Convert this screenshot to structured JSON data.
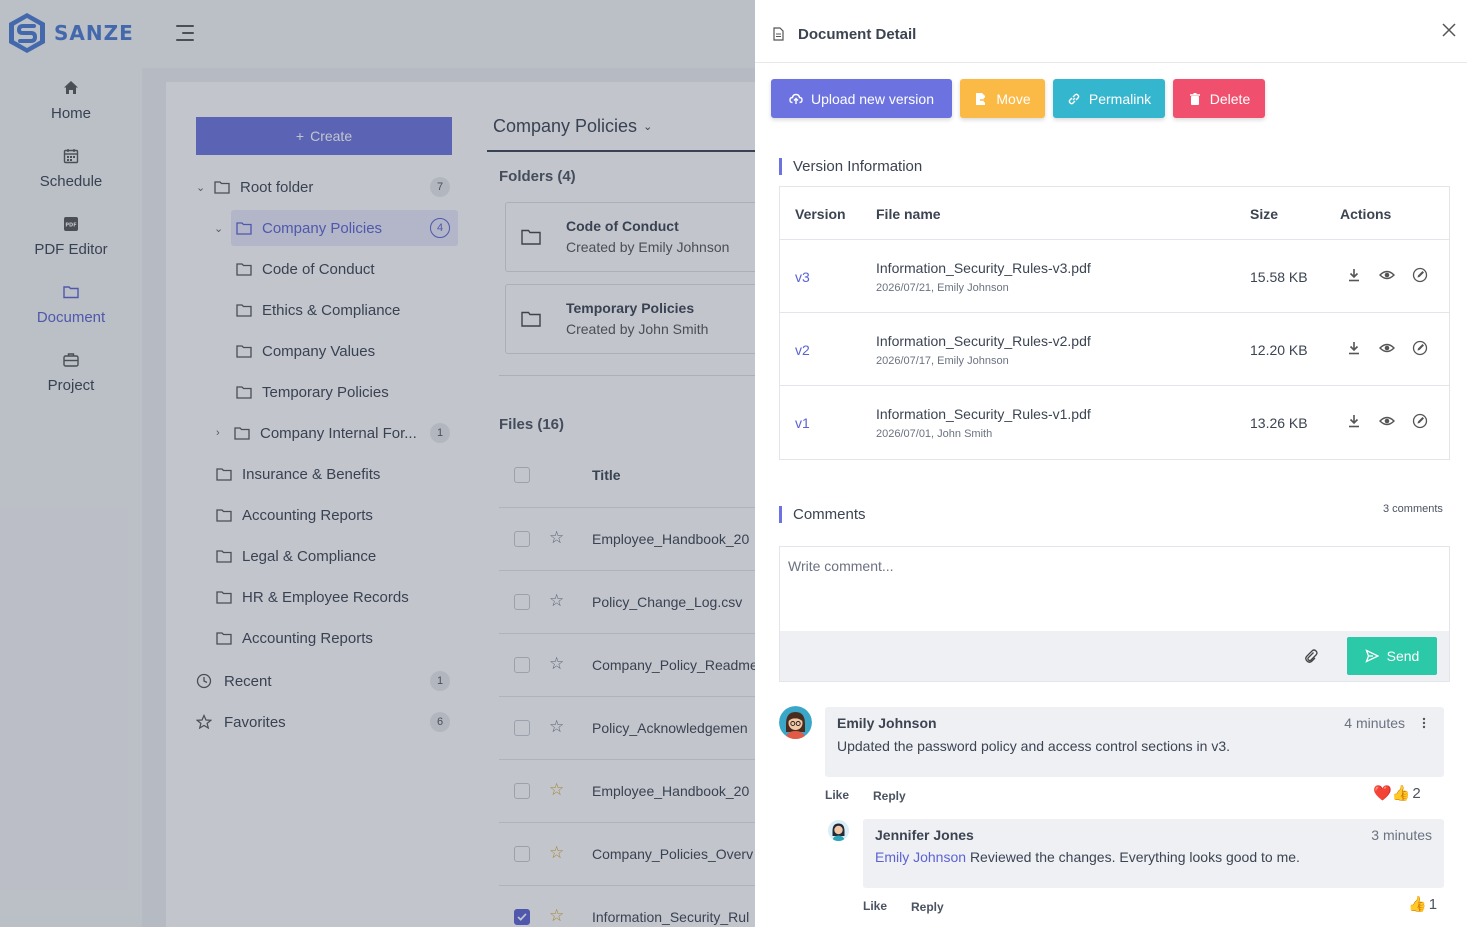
{
  "app": {
    "logo_text": "SANZE",
    "nav": [
      {
        "label": "Home",
        "icon": "home-icon"
      },
      {
        "label": "Schedule",
        "icon": "calendar-icon"
      },
      {
        "label": "PDF Editor",
        "icon": "pdf-icon"
      },
      {
        "label": "Document",
        "icon": "folder-icon",
        "active": true
      },
      {
        "label": "Project",
        "icon": "briefcase-icon"
      }
    ]
  },
  "tree": {
    "create_label": "Create",
    "root": {
      "label": "Root folder",
      "count": "7"
    },
    "selected": {
      "label": "Company Policies",
      "count": "4"
    },
    "children": [
      "Code of Conduct",
      "Ethics & Compliance",
      "Company Values",
      "Temporary Policies"
    ],
    "internal": {
      "label": "Company Internal For...",
      "count": "1"
    },
    "siblings": [
      "Insurance & Benefits",
      "Accounting Reports",
      "Legal & Compliance",
      "HR & Employee Records",
      "Accounting Reports"
    ],
    "recent": {
      "label": "Recent",
      "count": "1"
    },
    "favorites": {
      "label": "Favorites",
      "count": "6"
    }
  },
  "main": {
    "title": "Company Policies",
    "folders_label": "Folders (4)",
    "folders": [
      {
        "name": "Code of Conduct",
        "created": "Created by Emily Johnson"
      },
      {
        "name": "Temporary Policies",
        "created": "Created by John Smith"
      }
    ],
    "files_label": "Files (16)",
    "title_header": "Title",
    "files": [
      {
        "name": "Employee_Handbook_20",
        "starred": false,
        "checked": false
      },
      {
        "name": "Policy_Change_Log.csv",
        "starred": false,
        "checked": false
      },
      {
        "name": "Company_Policy_Readme",
        "starred": false,
        "checked": false
      },
      {
        "name": "Policy_Acknowledgemen",
        "starred": false,
        "checked": false
      },
      {
        "name": "Employee_Handbook_20",
        "starred": true,
        "checked": false
      },
      {
        "name": "Company_Policies_Overv",
        "starred": true,
        "checked": false
      },
      {
        "name": "Information_Security_Rul",
        "starred": true,
        "checked": true
      }
    ]
  },
  "drawer": {
    "title": "Document Detail",
    "buttons": {
      "upload": "Upload new version",
      "move": "Move",
      "permalink": "Permalink",
      "delete": "Delete"
    },
    "colors": {
      "primary": "#6c73e0",
      "warning": "#fbb946",
      "info": "#35b6cf",
      "danger": "#f0506e",
      "success": "#2cc9a8"
    },
    "version_section": "Version Information",
    "version_table": {
      "headers": {
        "version": "Version",
        "file": "File name",
        "size": "Size",
        "actions": "Actions"
      },
      "rows": [
        {
          "version": "v3",
          "file": "Information_Security_Rules-v3.pdf",
          "meta": "2026/07/21, Emily Johnson",
          "size": "15.58 KB"
        },
        {
          "version": "v2",
          "file": "Information_Security_Rules-v2.pdf",
          "meta": "2026/07/17, Emily Johnson",
          "size": "12.20 KB"
        },
        {
          "version": "v1",
          "file": "Information_Security_Rules-v1.pdf",
          "meta": "2026/07/01, John Smith",
          "size": "13.26 KB"
        }
      ]
    },
    "comments_section": "Comments",
    "comments_count": "3 comments",
    "comment_placeholder": "Write comment...",
    "send_label": "Send",
    "comments": [
      {
        "author": "Emily Johnson",
        "time": "4 minutes",
        "text": "Updated the password policy and access control sections in v3.",
        "like": "Like",
        "reply": "Reply",
        "reactions": "❤️👍",
        "reaction_count": "2"
      },
      {
        "author": "Jennifer Jones",
        "time": "3 minutes",
        "mention": "Emily Johnson",
        "text": "Reviewed the changes. Everything looks good to me.",
        "like": "Like",
        "reply": "Reply",
        "reactions": "👍",
        "reaction_count": "1"
      }
    ]
  }
}
